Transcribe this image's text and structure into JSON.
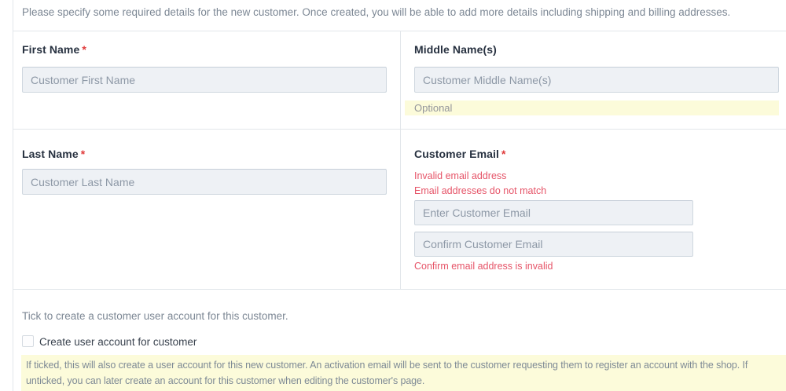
{
  "intro": {
    "text": "Please specify some required details for the new customer. Once created, you will be able to add more details including shipping and billing addresses."
  },
  "fields": {
    "first_name": {
      "label": "First Name",
      "required_mark": "*",
      "placeholder": "Customer First Name"
    },
    "middle_name": {
      "label": "Middle Name(s)",
      "placeholder": "Customer Middle Name(s)",
      "hint": "Optional"
    },
    "last_name": {
      "label": "Last Name",
      "required_mark": "*",
      "placeholder": "Customer Last Name"
    },
    "customer_email": {
      "label": "Customer Email",
      "required_mark": "*",
      "errors": [
        "Invalid email address",
        "Email addresses do not match"
      ],
      "email_placeholder": "Enter Customer Email",
      "confirm_placeholder": "Confirm Customer Email",
      "confirm_error": "Confirm email address is invalid"
    }
  },
  "account": {
    "instruction": "Tick to create a customer user account for this customer.",
    "checkbox_label": "Create user account for customer",
    "checkbox_checked": false,
    "note": "If ticked, this will also create a user account for this new customer. An activation email will be sent to the customer requesting them to register an account with the shop. If unticked, you can later create an account for this customer when editing the customer's page."
  },
  "colors": {
    "error": "#e65468",
    "required_mark": "#e03b3b",
    "hint_background": "#fcfbda",
    "input_background": "#eef1f5",
    "divider": "#e2e6ea"
  }
}
